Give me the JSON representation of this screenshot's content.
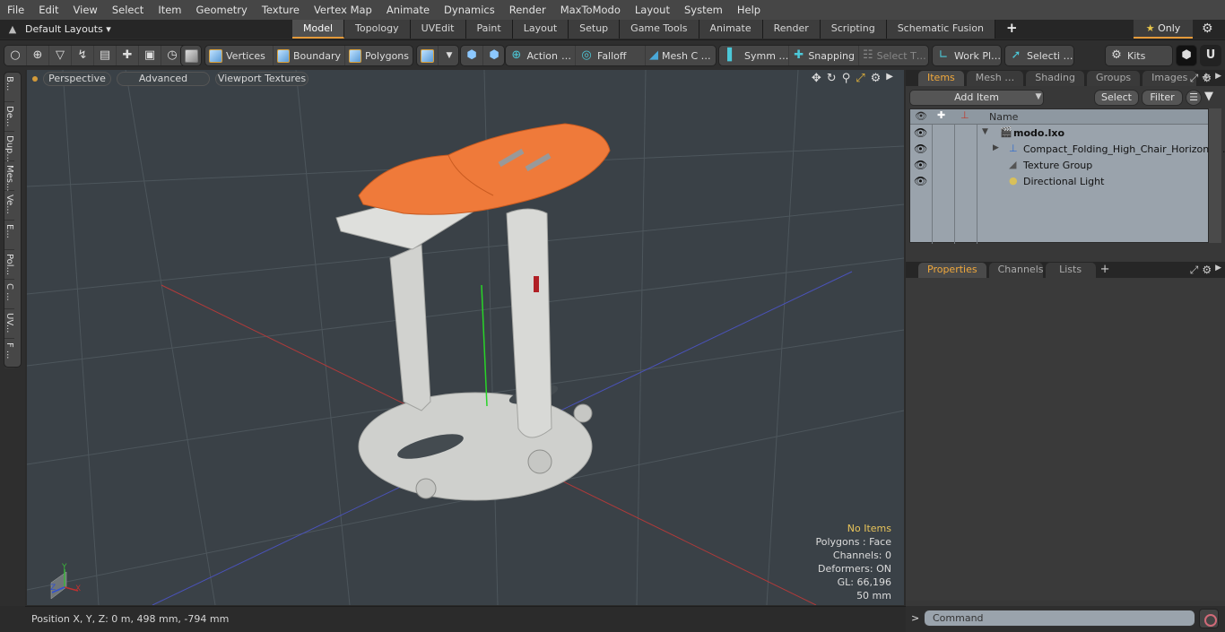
{
  "menu": [
    "File",
    "Edit",
    "View",
    "Select",
    "Item",
    "Geometry",
    "Texture",
    "Vertex Map",
    "Animate",
    "Dynamics",
    "Render",
    "MaxToModo",
    "Layout",
    "System",
    "Help"
  ],
  "layout_bar": {
    "default_layouts": "Default Layouts ▾",
    "tabs": [
      "Model",
      "Topology",
      "UVEdit",
      "Paint",
      "Layout",
      "Setup",
      "Game Tools",
      "Animate",
      "Render",
      "Scripting",
      "Schematic Fusion"
    ],
    "active_tab": "Model",
    "plus": "+",
    "only_label": "Only",
    "only_star": "★"
  },
  "toolbar": {
    "vertices": "Vertices",
    "boundary": "Boundary",
    "polygons": "Polygons",
    "action": "Action",
    "falloff": "Falloff",
    "mesh": "Mesh C …",
    "symmetry": "Symm …",
    "snapping": "Snapping",
    "select_t": "Select T…",
    "work_plane": "Work Pl…",
    "selection": "Selecti …",
    "kits": "Kits",
    "ellipsis": "…"
  },
  "left_tabs": [
    "B...",
    "De...",
    "Dup...",
    "Mes...",
    "Ve...",
    "E...",
    "Pol...",
    "C ...",
    "UV...",
    "F ..."
  ],
  "viewport": {
    "view_mode": "Perspective",
    "shading": "Advanced",
    "textures": "Viewport Textures",
    "info": {
      "selection": "No Items",
      "polygons": "Polygons : Face",
      "channels": "Channels: 0",
      "deformers": "Deformers: ON",
      "gl": "GL: 66,196",
      "scale": "50 mm"
    },
    "axis_labels": {
      "x": "X",
      "y": "Y",
      "z": "Z"
    }
  },
  "status": {
    "position": "Position X, Y, Z:   0 m, 498 mm, -794 mm"
  },
  "items_panel": {
    "tabs": [
      "Items",
      "Mesh …",
      "Shading",
      "Groups",
      "Images"
    ],
    "active_tab": "Items",
    "add_item": "Add Item",
    "select": "Select",
    "filter": "Filter",
    "column_name": "Name",
    "tree": [
      {
        "name": "modo.lxo",
        "level": 0,
        "icon": "scene-icon",
        "expanded": true,
        "bold": true
      },
      {
        "name": "Compact_Folding_High_Chair_Horizonta…",
        "level": 1,
        "icon": "mesh-locator-icon",
        "collapsed": true
      },
      {
        "name": "Texture Group",
        "level": 1,
        "icon": "texture-group-icon"
      },
      {
        "name": "Directional Light",
        "level": 1,
        "icon": "light-icon"
      }
    ]
  },
  "properties_panel": {
    "tabs": [
      "Properties",
      "Channels",
      "Lists"
    ],
    "active_tab": "Properties"
  },
  "command": {
    "prompt": ">",
    "placeholder": "Command"
  },
  "colors": {
    "accent": "#e49a3a",
    "active_tab_text": "#f0a83c",
    "info_warning": "#e8c45a",
    "seat": "#f07a3c",
    "chair_body": "#d4d5d2",
    "viewport_bg": "#3a4147"
  }
}
